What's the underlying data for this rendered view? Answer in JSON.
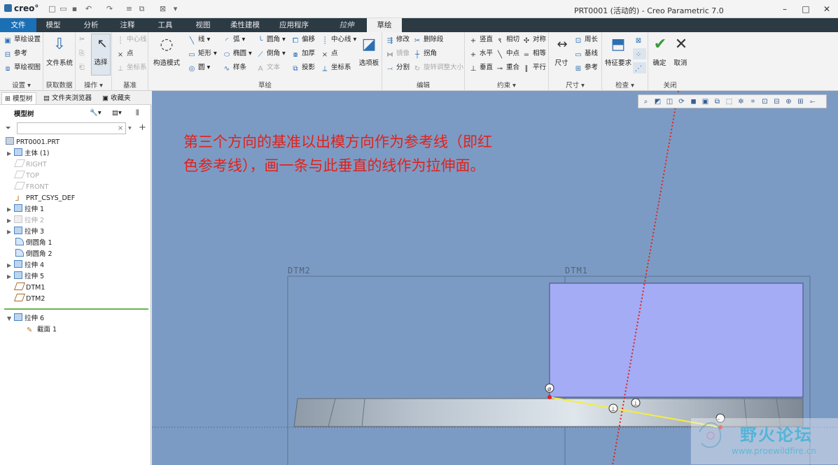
{
  "app": {
    "logo": "creo°",
    "window_title": "PRT0001 (活动的) - Creo Parametric 7.0"
  },
  "tabs": [
    {
      "label": "文件"
    },
    {
      "label": "模型"
    },
    {
      "label": "分析"
    },
    {
      "label": "注释"
    },
    {
      "label": "工具"
    },
    {
      "label": "视图"
    },
    {
      "label": "柔性建模"
    },
    {
      "label": "应用程序"
    },
    {
      "label": "拉伸"
    },
    {
      "label": "草绘"
    }
  ],
  "ribbon": {
    "setup": {
      "items": [
        "草绘设置",
        "参考",
        "草绘视图"
      ],
      "label": "设置"
    },
    "get_data": {
      "button": "文件系统",
      "label": "获取数据"
    },
    "operations": {
      "select": "选择",
      "label": "操作"
    },
    "datum": {
      "items": [
        "中心线",
        "点",
        "坐标系"
      ],
      "label": "基准"
    },
    "sketch": {
      "construction_mode": "构造模式",
      "col1": [
        "线",
        "矩形",
        "圆"
      ],
      "col2": [
        "弧",
        "椭圆",
        "样条"
      ],
      "col3": [
        "圆角",
        "倒角",
        "文本"
      ],
      "col4": [
        "偏移",
        "加厚",
        "投影"
      ],
      "col5": [
        "中心线",
        "点",
        "坐标系"
      ],
      "palette": "选项板",
      "label": "草绘"
    },
    "editing": {
      "col1": [
        "修改",
        "镜像",
        "分割"
      ],
      "col2": [
        "删除段",
        "拐角",
        "旋转调整大小"
      ],
      "label": "编辑"
    },
    "constrain": {
      "col1": [
        "竖直",
        "水平",
        "垂直"
      ],
      "col2": [
        "相切",
        "中点",
        "重合"
      ],
      "col3": [
        "对称",
        "相等",
        "平行"
      ],
      "label": "约束"
    },
    "dimension": {
      "button": "尺寸",
      "items": [
        "周长",
        "基线",
        "参考"
      ],
      "label": "尺寸"
    },
    "inspect": {
      "button": "特征要求",
      "label": "检查"
    },
    "close": {
      "ok": "确定",
      "cancel": "取消",
      "label": "关闭"
    }
  },
  "left_panel": {
    "tabs": [
      "模型树",
      "文件夹浏览器",
      "收藏夹"
    ],
    "header": "模型树",
    "tree": [
      {
        "label": "PRT0001.PRT",
        "dim": false
      },
      {
        "label": "主体 (1)",
        "dim": false
      },
      {
        "label": "RIGHT",
        "dim": true
      },
      {
        "label": "TOP",
        "dim": true
      },
      {
        "label": "FRONT",
        "dim": true
      },
      {
        "label": "PRT_CSYS_DEF",
        "dim": false
      },
      {
        "label": "拉伸 1",
        "dim": false
      },
      {
        "label": "拉伸 2",
        "dim": true
      },
      {
        "label": "拉伸 3",
        "dim": false
      },
      {
        "label": "倒圆角 1",
        "dim": false
      },
      {
        "label": "倒圆角 2",
        "dim": false
      },
      {
        "label": "拉伸 4",
        "dim": false
      },
      {
        "label": "拉伸 5",
        "dim": false
      },
      {
        "label": "DTM1",
        "dim": false
      },
      {
        "label": "DTM2",
        "dim": false
      },
      {
        "label": "拉伸 6",
        "dim": false
      },
      {
        "label": "截面 1",
        "dim": false
      }
    ]
  },
  "canvas": {
    "annotation_line1": "第三个方向的基准以出模方向作为参考线（即红",
    "annotation_line2": "色参考线），画一条与此垂直的线作为拉伸面。",
    "dtm2": "DTM2",
    "dtm1": "DTM1",
    "watermark_text": "野火论坛",
    "watermark_url": "www.proewildfire.cn",
    "colors": {
      "background": "#7c9bc4",
      "solid_fill": "#a3acf4",
      "reference_line": "#e0231c",
      "sketch_line": "#f3ee3e"
    }
  }
}
